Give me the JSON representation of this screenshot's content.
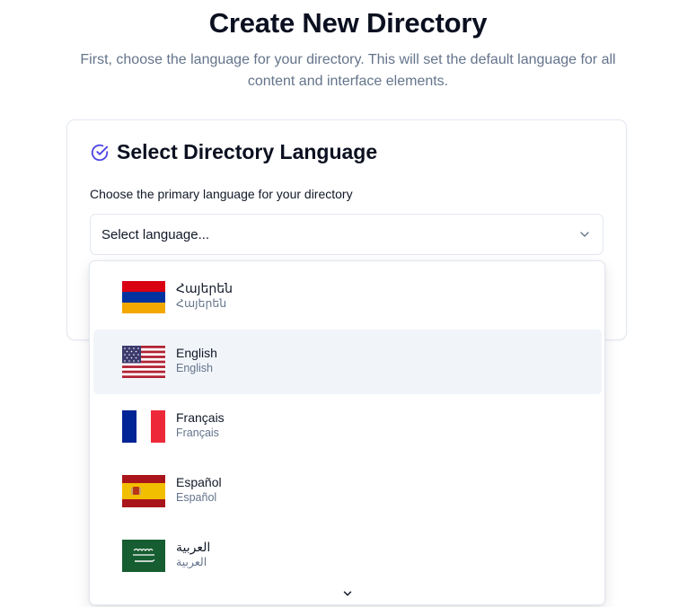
{
  "page": {
    "title": "Create New Directory",
    "subtitle": "First, choose the language for your directory. This will set the default language for all content and interface elements."
  },
  "card": {
    "icon": "check-circle-icon",
    "title": "Select Directory Language",
    "field_label": "Choose the primary language for your directory",
    "select": {
      "value": "Select language...",
      "icon": "chevron-down-icon"
    }
  },
  "dropdown": {
    "options": [
      {
        "name": "Հայերեն",
        "native": "Հայերեն",
        "flag": "armenia-flag-icon",
        "highlighted": false
      },
      {
        "name": "English",
        "native": "English",
        "flag": "usa-flag-icon",
        "highlighted": true
      },
      {
        "name": "Français",
        "native": "Français",
        "flag": "france-flag-icon",
        "highlighted": false
      },
      {
        "name": "Español",
        "native": "Español",
        "flag": "spain-flag-icon",
        "highlighted": false
      },
      {
        "name": "العربية",
        "native": "العربية",
        "flag": "saudi-arabia-flag-icon",
        "highlighted": false
      }
    ],
    "scroll_icon": "chevron-down-icon"
  },
  "colors": {
    "accent": "#4f46e5",
    "highlight": "#f1f5f9",
    "muted_text": "#64748b",
    "border": "#e2e8f0"
  }
}
